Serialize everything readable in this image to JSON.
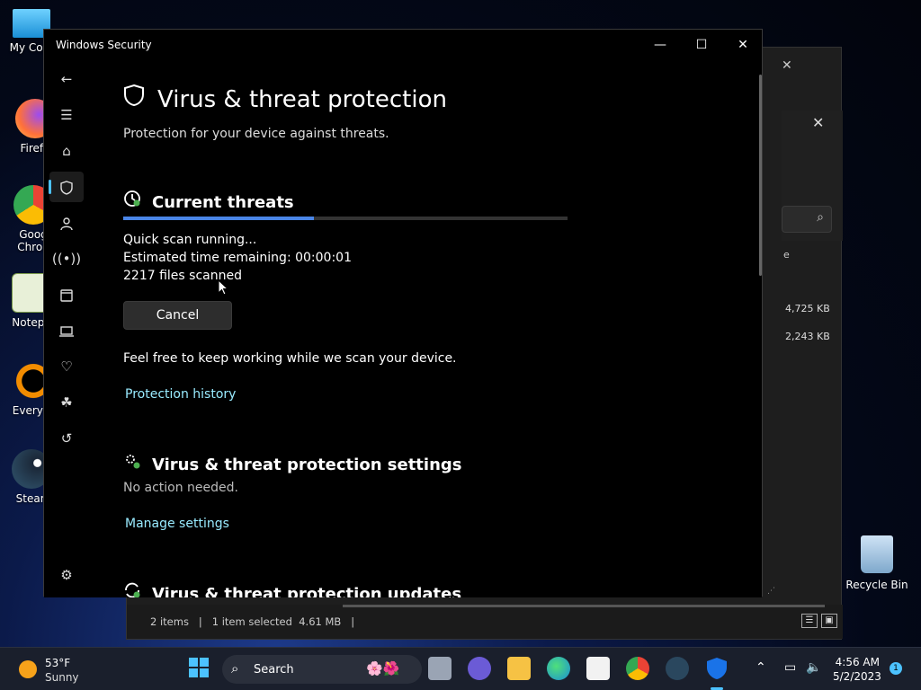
{
  "desktop": {
    "icons": [
      {
        "label": "My Com"
      },
      {
        "label": "Firefo"
      },
      {
        "label": "Goog"
      },
      {
        "label": "Chron"
      },
      {
        "label": "Notepa"
      },
      {
        "label": "Everyth"
      },
      {
        "label": "Stean"
      }
    ],
    "recycle_bin": "Recycle Bin"
  },
  "explorer": {
    "sizes": [
      "4,725 KB",
      "2,243 KB"
    ],
    "partial_col": "e",
    "status": "2 items   |   1 item selected  4.61 MB   |"
  },
  "window": {
    "title": "Windows Security",
    "minimize": "—",
    "maximize": "☐",
    "close": "✕"
  },
  "nav": {
    "back": "←",
    "menu": "☰",
    "items": [
      "home-icon",
      "shield-icon",
      "account-icon",
      "firewall-icon",
      "app-browser-icon",
      "device-security-icon",
      "device-health-icon",
      "family-icon",
      "history-icon"
    ],
    "settings": "gear-icon"
  },
  "page": {
    "title": "Virus & threat protection",
    "subtitle": "Protection for your device against threats.",
    "current_threats": {
      "heading": "Current threats",
      "progress": 0.43,
      "status": "Quick scan running...",
      "eta": "Estimated time remaining:  00:00:01",
      "files": "2217  files scanned",
      "cancel": "Cancel",
      "note": "Feel free to keep working while we scan your device.",
      "history_link": "Protection history"
    },
    "settings_section": {
      "heading": "Virus & threat protection settings",
      "status": "No action needed.",
      "link": "Manage settings"
    },
    "updates_section": {
      "heading": "Virus & threat protection updates"
    }
  },
  "taskbar": {
    "weather_temp": "53°F",
    "weather_desc": "Sunny",
    "search": "Search",
    "time": "4:56 AM",
    "date": "5/2/2023",
    "notification_count": "1"
  },
  "colors": {
    "accent": "#4cc2ff",
    "link": "#99ebff",
    "progress": "#4a86e8"
  }
}
